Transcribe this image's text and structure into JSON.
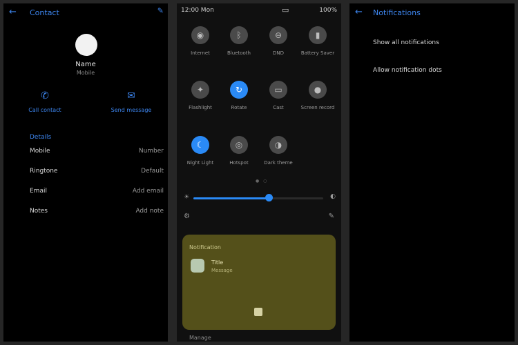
{
  "left": {
    "title": "Contact",
    "profile_name": "Name",
    "profile_sub": "Mobile",
    "actions": [
      {
        "icon": "phone-icon",
        "label": "Call contact"
      },
      {
        "icon": "message-icon",
        "label": "Send message"
      }
    ],
    "section_header": "Details",
    "rows": [
      {
        "label": "Mobile",
        "value": "Number"
      },
      {
        "label": "Ringtone",
        "value": "Default"
      },
      {
        "label": "Email",
        "value": "Add email"
      },
      {
        "label": "Notes",
        "value": "Add note"
      }
    ]
  },
  "middle": {
    "status_time": "12:00 Mon",
    "status_right": "100%",
    "tiles": [
      {
        "label": "Internet",
        "on": false,
        "icon": "wifi-icon"
      },
      {
        "label": "Bluetooth",
        "on": false,
        "icon": "bluetooth-icon"
      },
      {
        "label": "DND",
        "on": false,
        "icon": "dnd-icon"
      },
      {
        "label": "Battery Saver",
        "on": false,
        "icon": "battery-icon"
      },
      {
        "label": "Flashlight",
        "on": false,
        "icon": "flashlight-icon"
      },
      {
        "label": "Rotate",
        "on": true,
        "icon": "rotate-icon"
      },
      {
        "label": "Cast",
        "on": false,
        "icon": "cast-icon"
      },
      {
        "label": "Screen record",
        "on": false,
        "icon": "record-icon"
      },
      {
        "label": "Night Light",
        "on": true,
        "icon": "night-light-icon"
      },
      {
        "label": "Hotspot",
        "on": false,
        "icon": "hotspot-icon"
      },
      {
        "label": "Dark theme",
        "on": false,
        "icon": "dark-theme-icon"
      }
    ],
    "brightness_level": 0.58,
    "notification": {
      "header": "Notification",
      "title": "Title",
      "subtitle": "Message"
    },
    "footer": "Manage"
  },
  "right": {
    "title": "Notifications",
    "items": [
      "Show all notifications",
      "Allow notification dots"
    ]
  },
  "colors": {
    "accent": "#3d86f0",
    "tile_on": "#2a8af6",
    "notification_bg": "#54501a"
  }
}
